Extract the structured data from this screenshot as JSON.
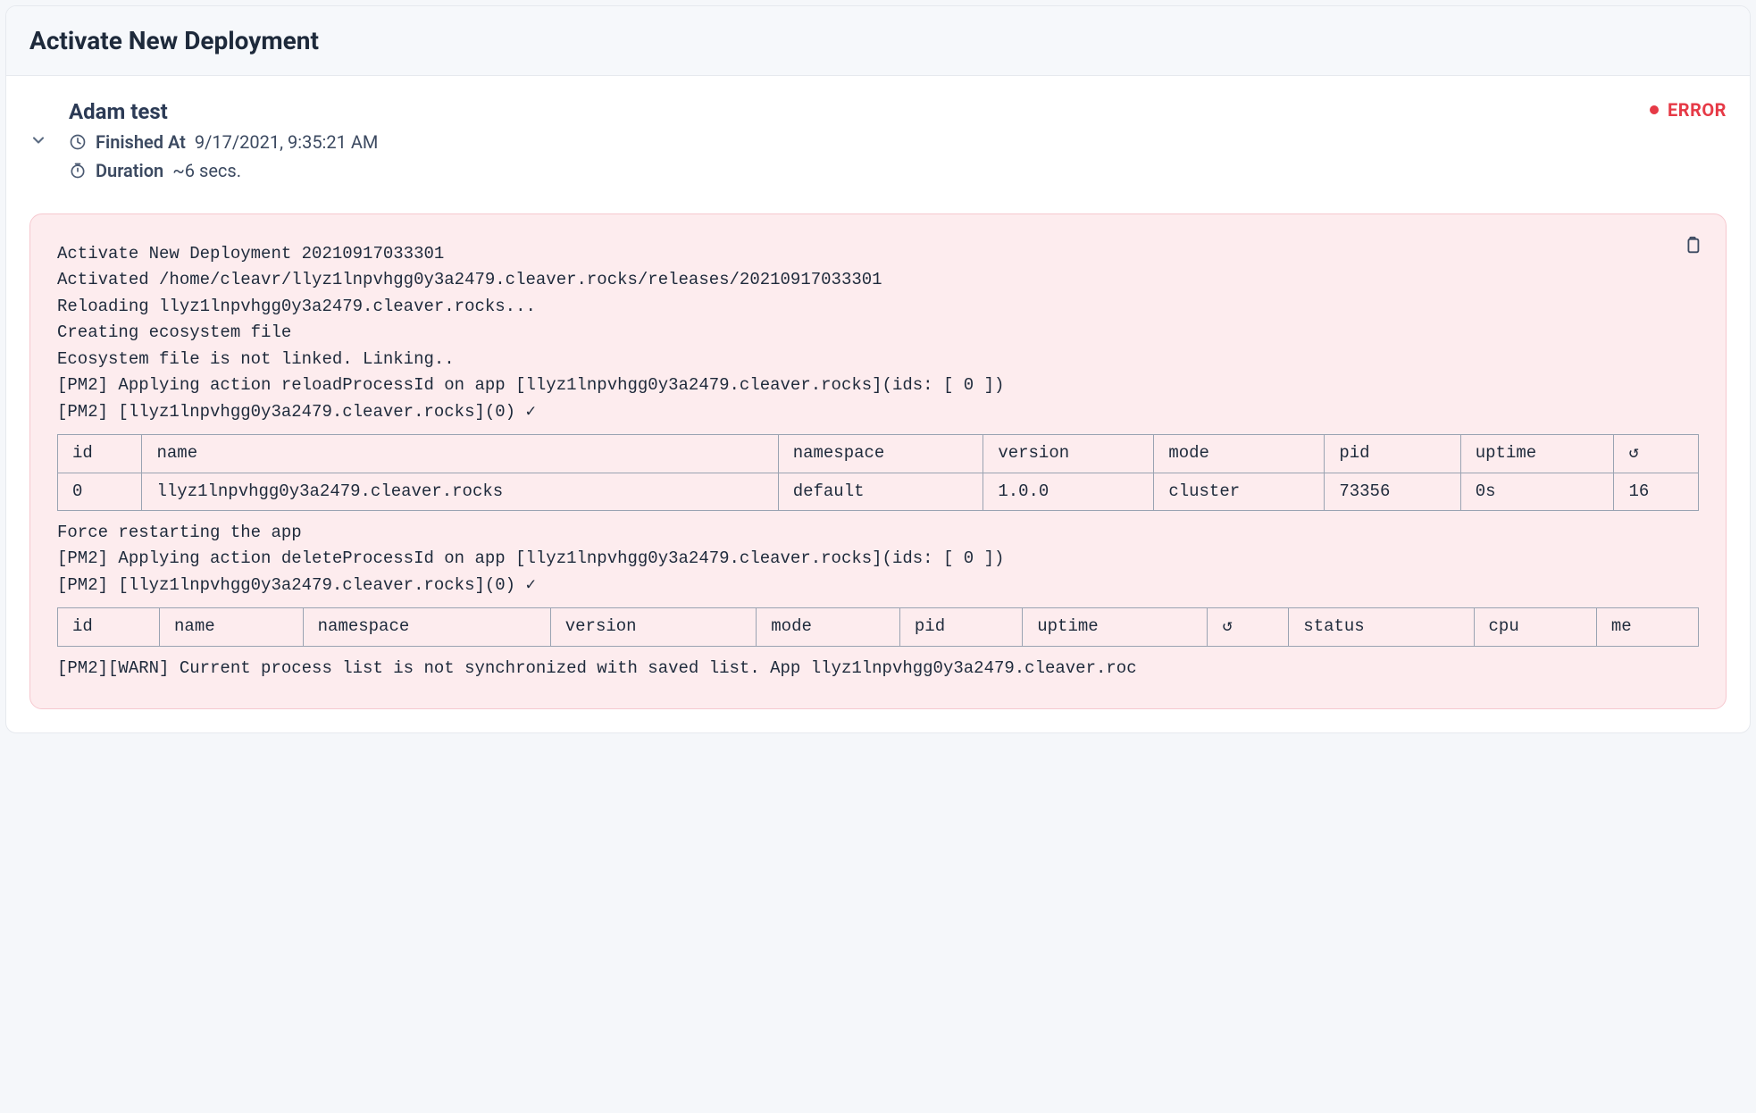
{
  "header": {
    "title": "Activate New Deployment"
  },
  "deployment": {
    "name": "Adam test",
    "finished_at_label": "Finished At",
    "finished_at_value": "9/17/2021, 9:35:21 AM",
    "duration_label": "Duration",
    "duration_value": "~6 secs.",
    "status_text": "ERROR",
    "status_color": "#e63946"
  },
  "log": {
    "lines_pre": [
      "Activate New Deployment 20210917033301",
      "Activated /home/cleavr/llyz1lnpvhgg0y3a2479.cleaver.rocks/releases/20210917033301",
      "Reloading llyz1lnpvhgg0y3a2479.cleaver.rocks...",
      "Creating ecosystem file",
      "Ecosystem file is not linked. Linking..",
      "[PM2] Applying action reloadProcessId on app [llyz1lnpvhgg0y3a2479.cleaver.rocks](ids: [ 0 ])",
      "[PM2] [llyz1lnpvhgg0y3a2479.cleaver.rocks](0) ✓"
    ],
    "table1": {
      "headers": [
        "id",
        "name",
        "namespace",
        "version",
        "mode",
        "pid",
        "uptime",
        "↺"
      ],
      "rows": [
        [
          "0",
          "llyz1lnpvhgg0y3a2479.cleaver.rocks",
          "default",
          "1.0.0",
          "cluster",
          "73356",
          "0s",
          "16"
        ]
      ]
    },
    "lines_mid": [
      "Force restarting the app",
      "[PM2] Applying action deleteProcessId on app [llyz1lnpvhgg0y3a2479.cleaver.rocks](ids: [ 0 ])",
      "[PM2] [llyz1lnpvhgg0y3a2479.cleaver.rocks](0) ✓"
    ],
    "table2": {
      "headers": [
        "id",
        "name",
        "namespace",
        "version",
        "mode",
        "pid",
        "uptime",
        "↺",
        "status",
        "cpu",
        "me"
      ],
      "rows": []
    },
    "lines_post": [
      "[PM2][WARN] Current process list is not synchronized with saved list. App llyz1lnpvhgg0y3a2479.cleaver.roc"
    ]
  }
}
